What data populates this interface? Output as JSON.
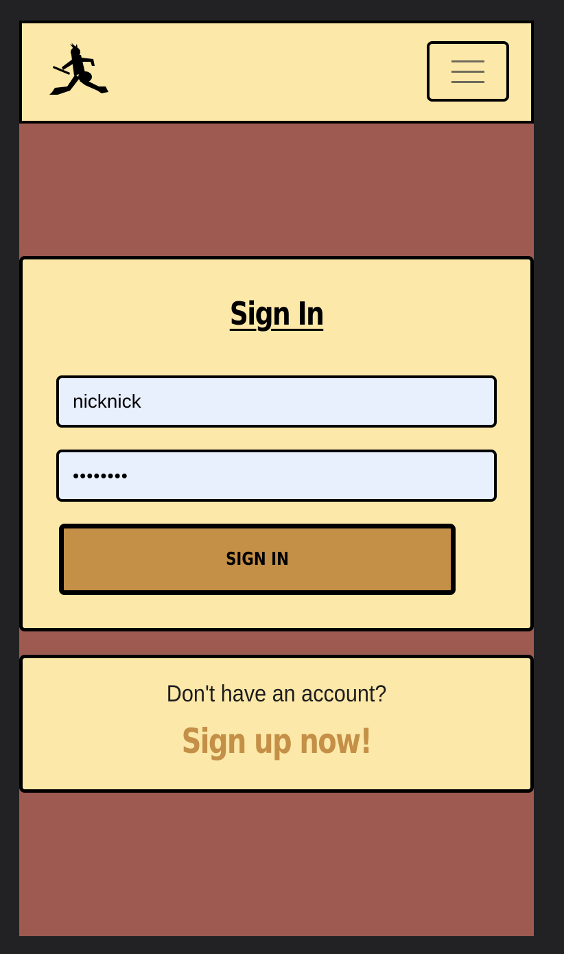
{
  "navbar": {
    "logo_icon": "jumping-guitarist-logo-icon",
    "menu_icon": "hamburger-menu-icon"
  },
  "signin": {
    "title": "Sign In",
    "username_value": "nicknick",
    "password_value": "••••••••",
    "button_label": "SIGN IN"
  },
  "signup": {
    "prompt": "Don't have an account?",
    "link_label": "Sign up now!"
  },
  "colors": {
    "page_background": "#222224",
    "content_background": "#9e5951",
    "card_background": "#fce8a8",
    "input_background": "#e8effd",
    "accent": "#c48f47",
    "border": "#000000"
  }
}
